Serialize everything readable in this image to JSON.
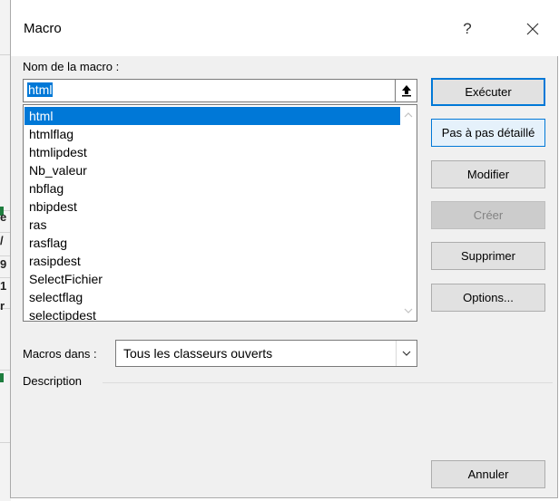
{
  "dialog": {
    "title": "Macro",
    "help_glyph": "?",
    "close_glyph": "✕"
  },
  "macro_name": {
    "label": "Nom de la macro :",
    "value": "html"
  },
  "macro_list": {
    "selected": "html",
    "items": [
      "html",
      "htmlflag",
      "htmlipdest",
      "Nb_valeur",
      "nbflag",
      "nbipdest",
      "ras",
      "rasflag",
      "rasipdest",
      "SelectFichier",
      "selectflag",
      "selectipdest"
    ]
  },
  "buttons": {
    "run": "Exécuter",
    "step": "Pas à pas détaillé",
    "edit": "Modifier",
    "create": "Créer",
    "delete": "Supprimer",
    "options": "Options...",
    "cancel": "Annuler"
  },
  "macros_in": {
    "label": "Macros dans :",
    "value": "Tous les classeurs ouverts"
  },
  "description": {
    "label": "Description"
  },
  "background": {
    "row_glyphs": [
      "e",
      "/",
      "9",
      "1",
      "r"
    ]
  },
  "colors": {
    "accent": "#0078d7",
    "dialog_bg": "#f0f0f0",
    "disabled_text": "#838383"
  }
}
